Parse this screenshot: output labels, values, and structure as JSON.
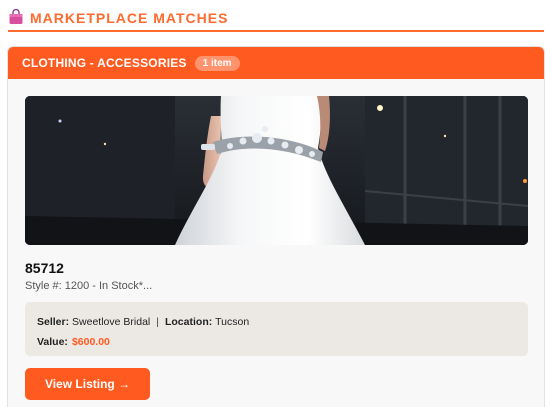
{
  "header": {
    "title": "MARKETPLACE MATCHES",
    "icon": "shopping-bag-icon"
  },
  "category": {
    "label": "CLOTHING - ACCESSORIES",
    "count_badge": "1 item"
  },
  "listing": {
    "id": "85712",
    "description": "Style #: 1200 - In Stock*...",
    "seller_label": "Seller:",
    "seller": "Sweetlove Bridal",
    "separator": "|",
    "location_label": "Location:",
    "location": "Tucson",
    "value_label": "Value:",
    "value": "$600.00",
    "button_label": "View Listing →",
    "image": "wedding-dress-photo"
  },
  "colors": {
    "accent": "#ff5a1f",
    "header_text": "#ff6a2e",
    "info_bg": "#ece9e4"
  }
}
